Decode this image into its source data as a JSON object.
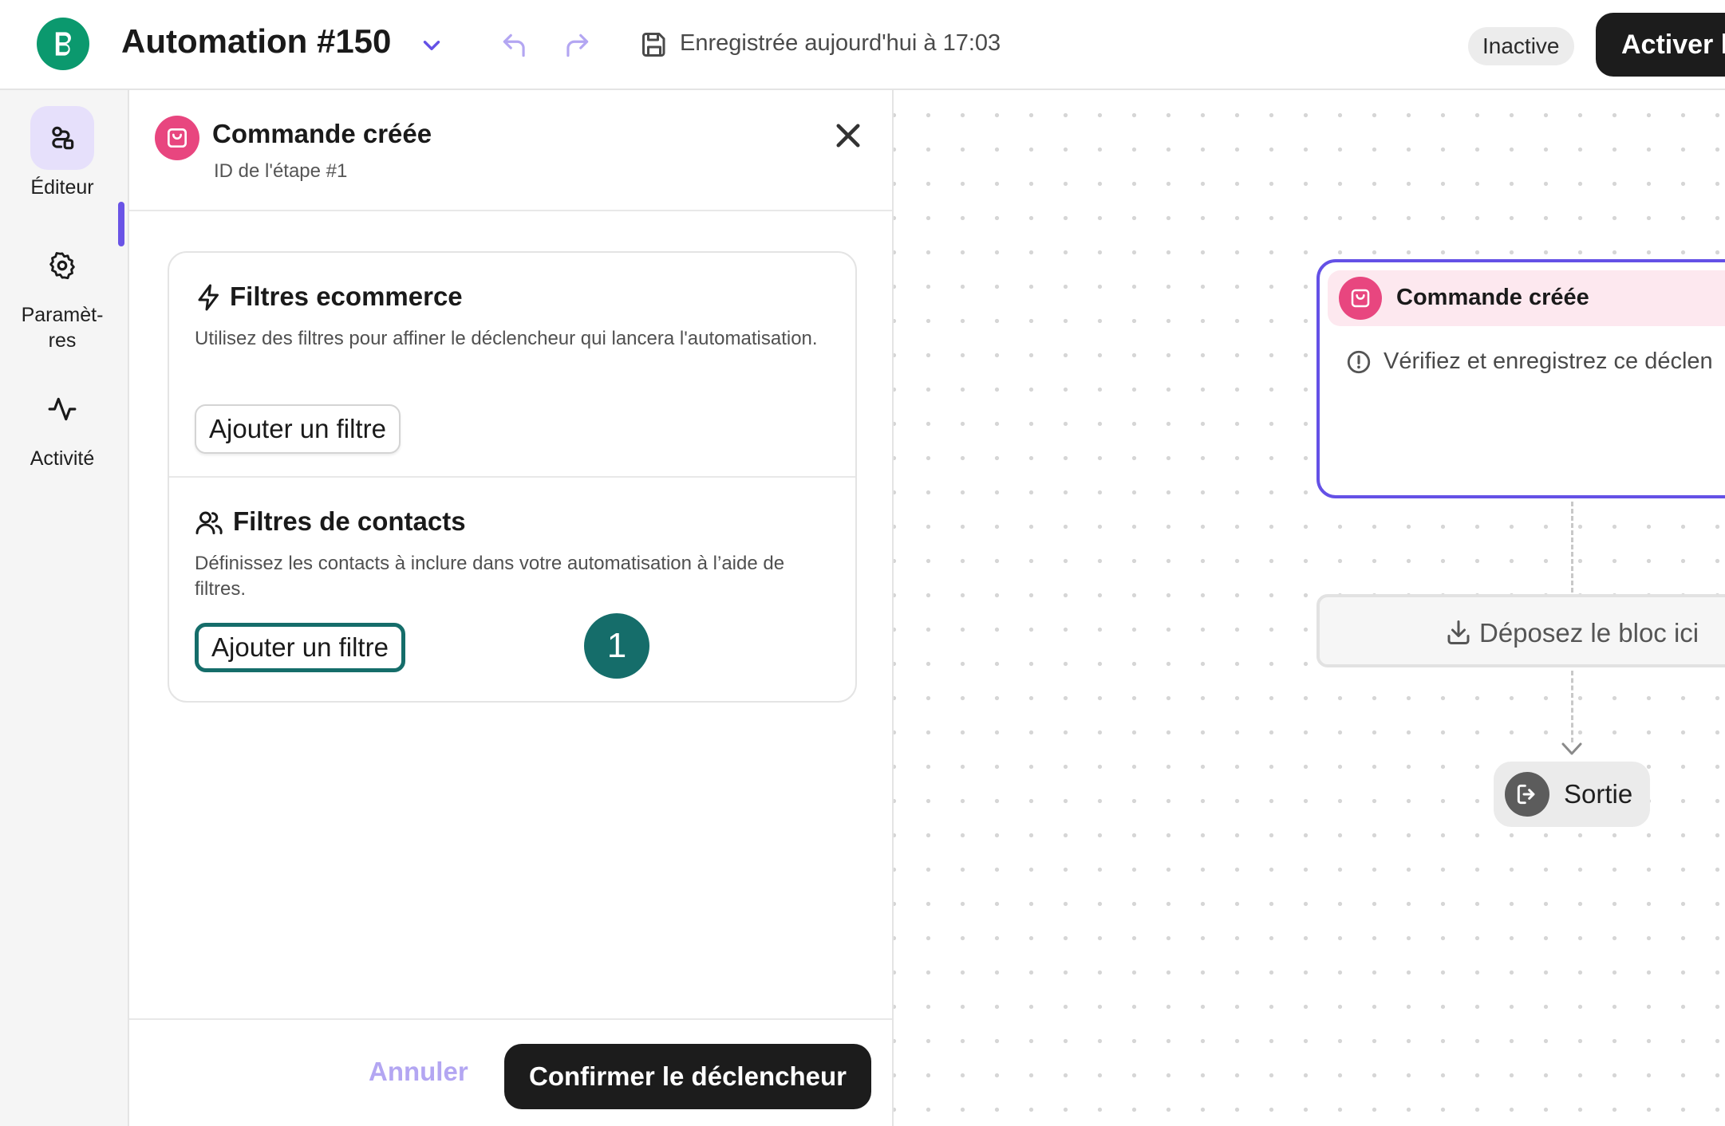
{
  "header": {
    "title": "Automation #150",
    "save_status": "Enregistrée aujourd'hui à 17:03",
    "status_badge": "Inactive",
    "activate_label": "Activer l'"
  },
  "sidebar": {
    "items": [
      {
        "label": "Éditeur",
        "icon": "editor-icon",
        "active": true
      },
      {
        "label": "Paramèt-\nres",
        "icon": "gear-icon",
        "active": false
      },
      {
        "label": "Activité",
        "icon": "activity-icon",
        "active": false
      }
    ]
  },
  "panel": {
    "title": "Commande créée",
    "subtitle": "ID de l'étape #1",
    "sections": [
      {
        "title": "Filtres ecommerce",
        "description": "Utilisez des filtres pour affiner le déclencheur qui lancera l'automatisation.",
        "button_label": "Ajouter un filtre"
      },
      {
        "title": "Filtres de contacts",
        "description": "Définissez les contacts à inclure dans votre automatisation à l’aide de filtres.",
        "button_label": "Ajouter un filtre"
      }
    ],
    "step_marker": "1",
    "cancel_label": "Annuler",
    "confirm_label": "Confirmer le déclencheur"
  },
  "canvas": {
    "trigger_title": "Commande créée",
    "trigger_warning": "Vérifiez et enregistrez ce déclen",
    "drop_label": "Déposez le bloc ici",
    "exit_label": "Sortie"
  },
  "colors": {
    "brand_green": "#0b996e",
    "accent_purple": "#6451e6",
    "ecommerce_pink": "#e8467f",
    "highlight_teal": "#156d6a"
  }
}
